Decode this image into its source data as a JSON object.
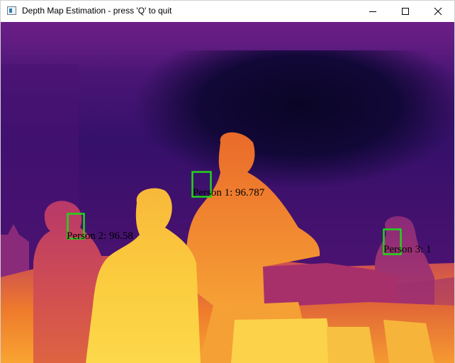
{
  "window": {
    "title": "Depth Map Estimation - press 'Q' to quit",
    "controls": [
      "minimize",
      "maximize",
      "close"
    ]
  },
  "viewer": {
    "box_color": "#22d41a",
    "colormap": "inferno",
    "detections": [
      {
        "label": "Person 1: 96.787"
      },
      {
        "label": "Person 2: 96.58"
      },
      {
        "label": "Person 3: 1"
      }
    ]
  }
}
